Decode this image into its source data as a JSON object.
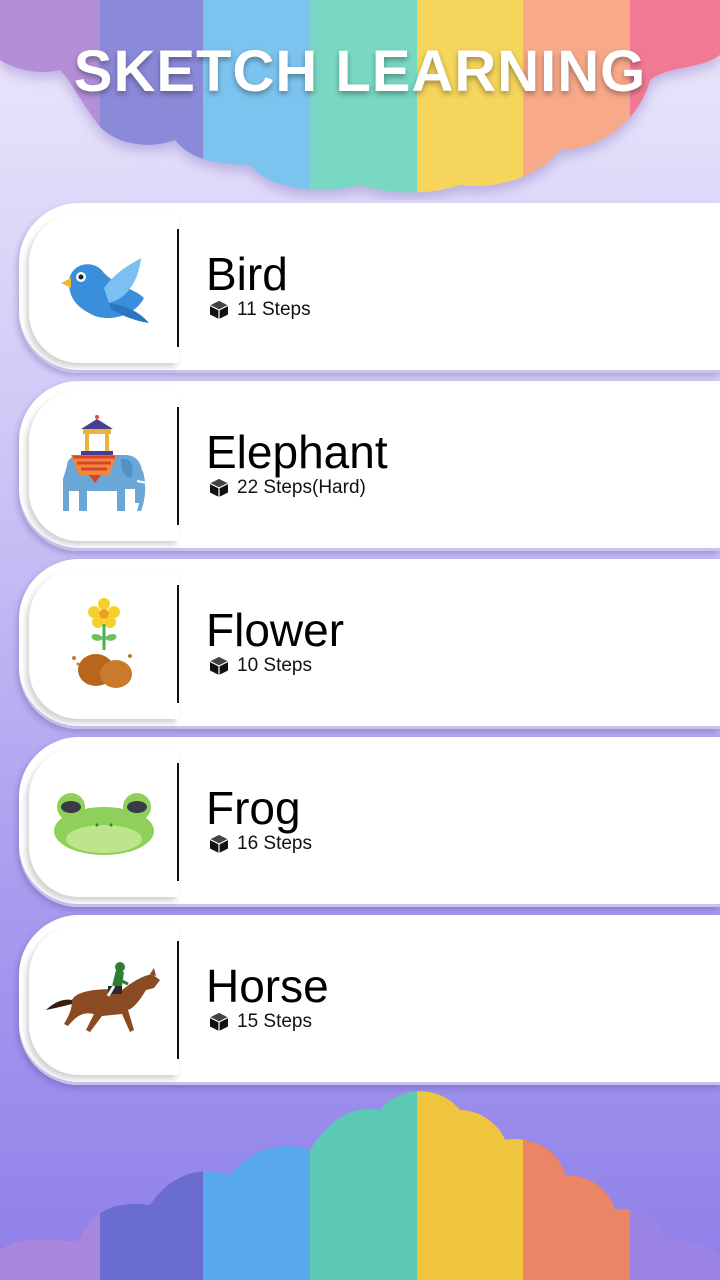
{
  "app": {
    "title": "SKETCH LEARNING"
  },
  "items": [
    {
      "name": "Bird",
      "steps": "11 Steps",
      "icon": "bird-icon"
    },
    {
      "name": "Elephant",
      "steps": "22 Steps(Hard)",
      "icon": "elephant-icon"
    },
    {
      "name": "Flower",
      "steps": "10 Steps",
      "icon": "flower-icon"
    },
    {
      "name": "Frog",
      "steps": "16 Steps",
      "icon": "frog-icon"
    },
    {
      "name": "Horse",
      "steps": "15 Steps",
      "icon": "horse-icon"
    }
  ],
  "colors": {
    "stripes": [
      "#b48fd8",
      "#8b8ad8",
      "#7cc4ef",
      "#79d8c4",
      "#f6d55c",
      "#f8a989",
      "#f07a93"
    ],
    "stripes_bottom": [
      "#a786db",
      "#6b6ccf",
      "#58a9ec",
      "#5cc9b4",
      "#efc43e",
      "#ea8566",
      "#9b84e6"
    ]
  }
}
